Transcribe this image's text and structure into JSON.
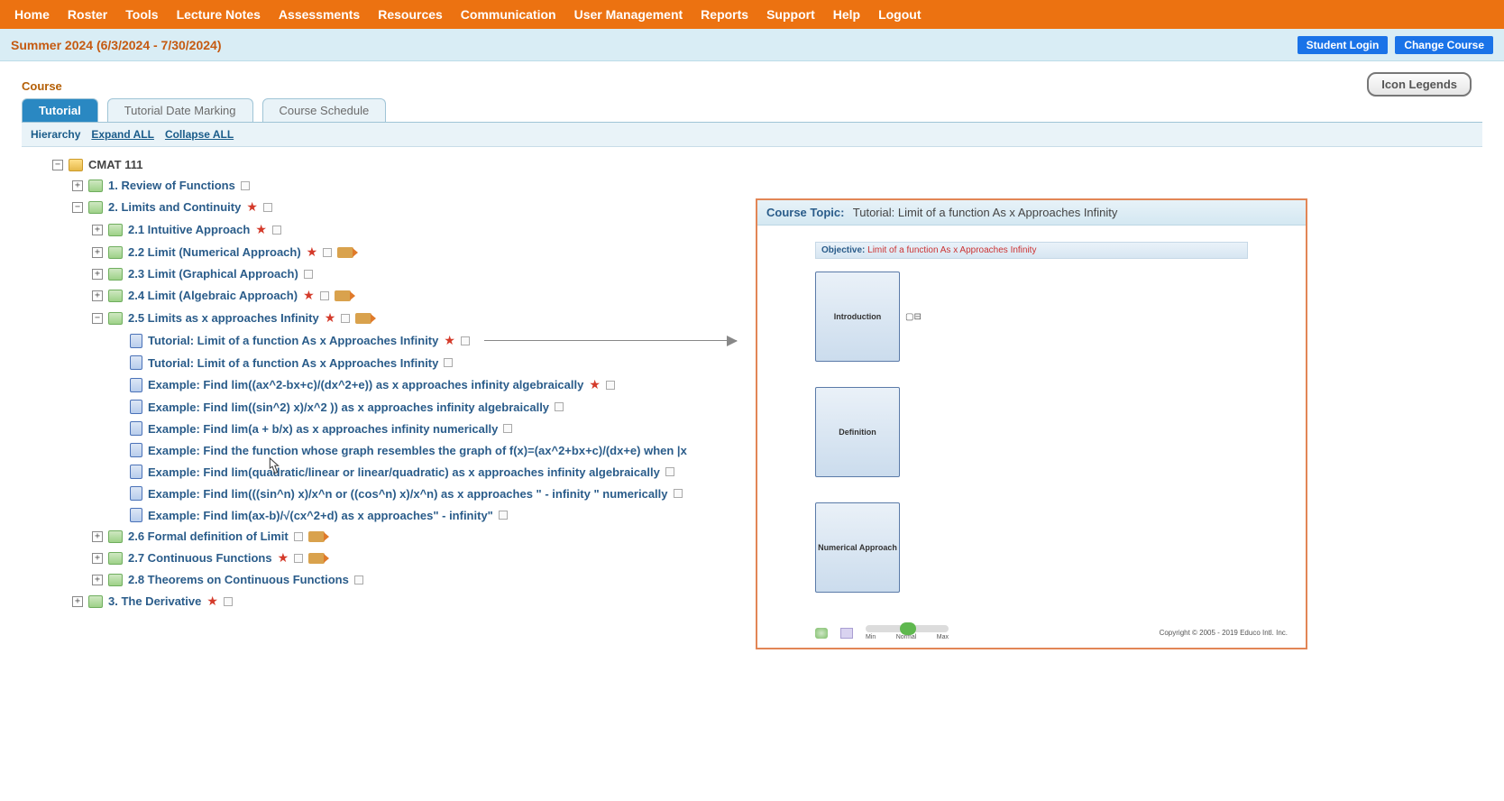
{
  "nav": {
    "items": [
      "Home",
      "Roster",
      "Tools",
      "Lecture Notes",
      "Assessments",
      "Resources",
      "Communication",
      "User Management",
      "Reports",
      "Support",
      "Help",
      "Logout"
    ]
  },
  "subbar": {
    "term": "Summer 2024 (6/3/2024 - 7/30/2024)",
    "student_login": "Student Login",
    "change_course": "Change Course"
  },
  "page": {
    "course_label": "Course",
    "icon_legends": "Icon Legends"
  },
  "tabs": {
    "items": [
      "Tutorial",
      "Tutorial Date Marking",
      "Course Schedule"
    ],
    "active": 0
  },
  "toolbar": {
    "hierarchy": "Hierarchy",
    "expand": "Expand ALL",
    "collapse": "Collapse ALL"
  },
  "tree": {
    "root": "CMAT 111",
    "n1": "1. Review of Functions",
    "n2": "2. Limits and Continuity",
    "n21": "2.1 Intuitive Approach",
    "n22": "2.2 Limit (Numerical Approach)",
    "n23": "2.3 Limit (Graphical Approach)",
    "n24": "2.4 Limit (Algebraic Approach)",
    "n25": "2.5 Limits as x approaches Infinity",
    "d1": "Tutorial: Limit of a function As x Approaches Infinity",
    "d2": "Tutorial: Limit of a function As x Approaches Infinity",
    "d3": "Example: Find lim((ax^2-bx+c)/(dx^2+e)) as x approaches infinity algebraically",
    "d4": "Example: Find lim((sin^2) x)/x^2 )) as x approaches infinity algebraically",
    "d5": "Example: Find lim(a + b/x) as x approaches infinity numerically",
    "d6": "Example: Find the function whose graph resembles the graph of f(x)=(ax^2+bx+c)/(dx+e) when |x",
    "d7": "Example: Find lim(quadratic/linear or linear/quadratic) as x approaches infinity algebraically",
    "d8": "Example: Find lim(((sin^n) x)/x^n or ((cos^n) x)/x^n) as x approaches \" - infinity \" numerically",
    "d9": "Example: Find lim(ax-b)/√(cx^2+d) as x approaches\" - infinity\"",
    "n26": "2.6 Formal definition of Limit",
    "n27": "2.7 Continuous Functions",
    "n28": "2.8 Theorems on Continuous Functions",
    "n3": "3. The Derivative"
  },
  "panel": {
    "title_label": "Course Topic:",
    "title_value": "Tutorial: Limit of a function As x Approaches Infinity",
    "objective_label": "Objective:",
    "objective_value": "Limit of a function As x Approaches Infinity",
    "tiles": [
      "Introduction",
      "Definition",
      "Numerical Approach"
    ],
    "slider": {
      "min": "Min",
      "normal": "Normal",
      "max": "Max"
    },
    "copyright": "Copyright © 2005 - 2019 Educo Intl. Inc."
  }
}
